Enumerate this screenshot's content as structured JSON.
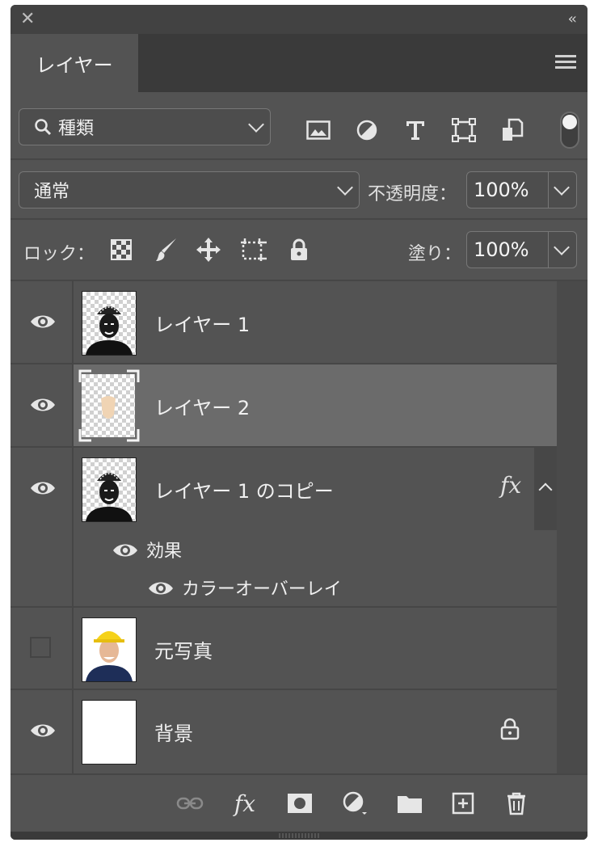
{
  "panel": {
    "tab_label": "レイヤー"
  },
  "filter": {
    "kind_label": "種類",
    "icons": [
      "image-filter-icon",
      "adjustment-filter-icon",
      "type-filter-icon",
      "shape-filter-icon",
      "smart-object-filter-icon"
    ]
  },
  "blend": {
    "mode": "通常",
    "opacity_label": "不透明度：",
    "opacity_value": "100%"
  },
  "lock": {
    "label": "ロック：",
    "fill_label": "塗り：",
    "fill_value": "100%"
  },
  "layers": [
    {
      "name": "レイヤー 1",
      "visible": true
    },
    {
      "name": "レイヤー 2",
      "visible": true,
      "selected": true
    },
    {
      "name": "レイヤー 1 のコピー",
      "visible": true,
      "fx": "fx",
      "effects_label": "効果",
      "effect_name": "カラーオーバーレイ"
    },
    {
      "name": "元写真",
      "visible": false
    },
    {
      "name": "背景",
      "visible": true,
      "locked": true
    }
  ],
  "colors": {
    "panel_bg": "#535353",
    "selected_row": "#6b6b6b",
    "skin_tone": "#f0d4b4",
    "helmet_yellow": "#f5d21a",
    "shirt_navy": "#1e2e58"
  }
}
